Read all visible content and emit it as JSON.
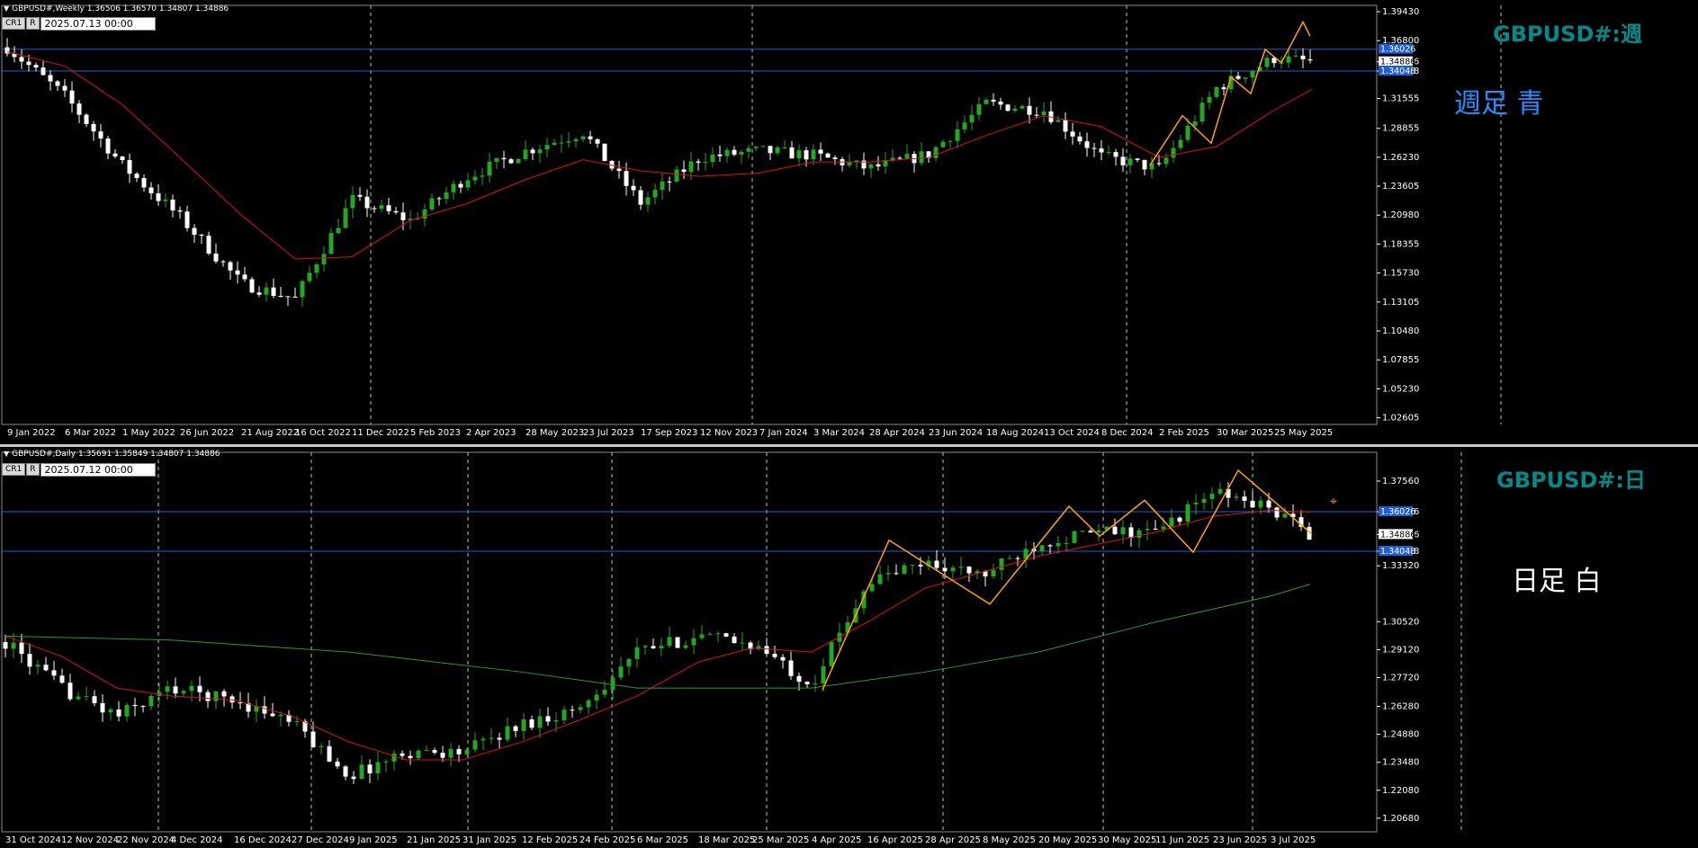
{
  "weekly": {
    "info": "GBPUSD#,Weekly  1.36506 1.36570 1.34807 1.34886",
    "buttons": [
      "CR1",
      "R"
    ],
    "datetime": "2025.07.13 00:00",
    "title": "GBPUSD#:週",
    "note": "週足  青",
    "price_ticks": [
      "1.39430",
      "1.36800",
      "1.34886",
      "1.34048",
      "1.31555",
      "1.28855",
      "1.26230",
      "1.23605",
      "1.20980",
      "1.18355",
      "1.15730",
      "1.13105",
      "1.10480",
      "1.07855",
      "1.05230",
      "1.02605"
    ],
    "hline_tags": [
      "1.36026",
      "1.34886",
      "1.34048"
    ],
    "date_labels": [
      "9 Jan 2022",
      "6 Mar 2022",
      "1 May 2022",
      "26 Jun 2022",
      "21 Aug 2022",
      "16 Oct 2022",
      "11 Dec 2022",
      "5 Feb 2023",
      "2 Apr 2023",
      "28 May 2023",
      "23 Jul 2023",
      "17 Sep 2023",
      "12 Nov 2023",
      "7 Jan 2024",
      "3 Mar 2024",
      "28 Apr 2024",
      "23 Jun 2024",
      "18 Aug 2024",
      "13 Oct 2024",
      "8 Dec 2024",
      "2 Feb 2025",
      "30 Mar 2025",
      "25 May 2025"
    ],
    "colors": {
      "bull": "#22a822",
      "bear": "#ffffff",
      "ma": "#e01010",
      "zigzag": "#ffa500",
      "hline": "#1e5fd8",
      "title": "#008b8b",
      "note": "#1e90ff"
    }
  },
  "daily": {
    "info": "GBPUSD#,Daily  1.35691 1.35849 1.34807 1.34886",
    "buttons": [
      "CR1",
      "R"
    ],
    "datetime": "2025.07.12 00:00",
    "title": "GBPUSD#:日",
    "note": "日足    白",
    "price_ticks": [
      "1.37560",
      "1.36026",
      "1.34886",
      "1.34048",
      "1.33320",
      "1.30520",
      "1.29120",
      "1.27720",
      "1.26280",
      "1.24880",
      "1.23480",
      "1.22080",
      "1.20680"
    ],
    "hline_tags": [
      "1.36026",
      "1.34886",
      "1.34048"
    ],
    "date_labels": [
      "31 Oct 2024",
      "12 Nov 2024",
      "22 Nov 2024",
      "4 Dec 2024",
      "16 Dec 2024",
      "27 Dec 2024",
      "9 Jan 2025",
      "21 Jan 2025",
      "31 Jan 2025",
      "12 Feb 2025",
      "24 Feb 2025",
      "6 Mar 2025",
      "18 Mar 2025",
      "25 Mar 2025",
      "4 Apr 2025",
      "16 Apr 2025",
      "28 Apr 2025",
      "8 May 2025",
      "20 May 2025",
      "30 May 2025",
      "11 Jun 2025",
      "23 Jun 2025",
      "3 Jul 2025"
    ],
    "colors": {
      "bull": "#22a822",
      "bear": "#ffffff",
      "ma_fast": "#e01010",
      "ma_slow": "#2a9a2a",
      "zigzag": "#ffa500",
      "hline": "#1e5fd8",
      "title": "#008b8b",
      "note": "#ffffff"
    }
  },
  "chart_data": [
    {
      "type": "candlestick",
      "title": "GBPUSD#:週",
      "timeframe": "Weekly",
      "ylim": [
        1.02,
        1.4
      ],
      "last_ohlc": {
        "open": 1.36506,
        "high": 1.3657,
        "low": 1.34807,
        "close": 1.34886
      },
      "horizontal_lines": [
        1.36026,
        1.34048
      ],
      "close_trace": [
        [
          "9 Jan 2022",
          1.362
        ],
        [
          "6 Mar 2022",
          1.318
        ],
        [
          "1 May 2022",
          1.255
        ],
        [
          "26 Jun 2022",
          1.208
        ],
        [
          "21 Aug 2022",
          1.148
        ],
        [
          "16 Oct 2022",
          1.134
        ],
        [
          "11 Dec 2022",
          1.224
        ],
        [
          "5 Feb 2023",
          1.205
        ],
        [
          "2 Apr 2023",
          1.244
        ],
        [
          "28 May 2023",
          1.268
        ],
        [
          "23 Jul 2023",
          1.285
        ],
        [
          "17 Sep 2023",
          1.221
        ],
        [
          "12 Nov 2023",
          1.262
        ],
        [
          "7 Jan 2024",
          1.268
        ],
        [
          "3 Mar 2024",
          1.264
        ],
        [
          "28 Apr 2024",
          1.252
        ],
        [
          "23 Jun 2024",
          1.265
        ],
        [
          "18 Aug 2024",
          1.311
        ],
        [
          "13 Oct 2024",
          1.305
        ],
        [
          "8 Dec 2024",
          1.263
        ],
        [
          "2 Feb 2025",
          1.252
        ],
        [
          "30 Mar 2025",
          1.325
        ],
        [
          "25 May 2025",
          1.352
        ],
        [
          "13 Jul 2025",
          1.349
        ]
      ],
      "ma_trace": [
        [
          "9 Jan 2022",
          1.358
        ],
        [
          "6 Mar 2022",
          1.345
        ],
        [
          "1 May 2022",
          1.31
        ],
        [
          "26 Jun 2022",
          1.262
        ],
        [
          "21 Aug 2022",
          1.21
        ],
        [
          "16 Oct 2022",
          1.17
        ],
        [
          "11 Dec 2022",
          1.172
        ],
        [
          "5 Feb 2023",
          1.205
        ],
        [
          "2 Apr 2023",
          1.22
        ],
        [
          "28 May 2023",
          1.242
        ],
        [
          "23 Jul 2023",
          1.26
        ],
        [
          "17 Sep 2023",
          1.25
        ],
        [
          "12 Nov 2023",
          1.245
        ],
        [
          "7 Jan 2024",
          1.248
        ],
        [
          "3 Mar 2024",
          1.258
        ],
        [
          "28 Apr 2024",
          1.258
        ],
        [
          "23 Jun 2024",
          1.262
        ],
        [
          "18 Aug 2024",
          1.282
        ],
        [
          "13 Oct 2024",
          1.3
        ],
        [
          "8 Dec 2024",
          1.29
        ],
        [
          "2 Feb 2025",
          1.262
        ],
        [
          "30 Mar 2025",
          1.272
        ],
        [
          "25 May 2025",
          1.305
        ],
        [
          "13 Jul 2025",
          1.324
        ]
      ]
    },
    {
      "type": "candlestick",
      "title": "GBPUSD#:日",
      "timeframe": "Daily",
      "ylim": [
        1.2,
        1.39
      ],
      "last_ohlc": {
        "open": 1.35691,
        "high": 1.35849,
        "low": 1.34807,
        "close": 1.34886
      },
      "horizontal_lines": [
        1.36026,
        1.34048
      ],
      "close_trace": [
        [
          "31 Oct 2024",
          1.295
        ],
        [
          "12 Nov 2024",
          1.272
        ],
        [
          "22 Nov 2024",
          1.258
        ],
        [
          "4 Dec 2024",
          1.272
        ],
        [
          "16 Dec 2024",
          1.266
        ],
        [
          "27 Dec 2024",
          1.255
        ],
        [
          "9 Jan 2025",
          1.228
        ],
        [
          "21 Jan 2025",
          1.24
        ],
        [
          "31 Jan 2025",
          1.24
        ],
        [
          "12 Feb 2025",
          1.254
        ],
        [
          "24 Feb 2025",
          1.262
        ],
        [
          "6 Mar 2025",
          1.29
        ],
        [
          "18 Mar 2025",
          1.298
        ],
        [
          "25 Mar 2025",
          1.294
        ],
        [
          "4 Apr 2025",
          1.274
        ],
        [
          "16 Apr 2025",
          1.325
        ],
        [
          "28 Apr 2025",
          1.335
        ],
        [
          "8 May 2025",
          1.328
        ],
        [
          "20 May 2025",
          1.345
        ],
        [
          "30 May 2025",
          1.35
        ],
        [
          "11 Jun 2025",
          1.35
        ],
        [
          "23 Jun 2025",
          1.37
        ],
        [
          "3 Jul 2025",
          1.362
        ],
        [
          "11 Jul 2025",
          1.349
        ]
      ],
      "ma_fast_trace": [
        [
          "31 Oct 2024",
          1.298
        ],
        [
          "12 Nov 2024",
          1.288
        ],
        [
          "22 Nov 2024",
          1.272
        ],
        [
          "4 Dec 2024",
          1.268
        ],
        [
          "16 Dec 2024",
          1.266
        ],
        [
          "27 Dec 2024",
          1.258
        ],
        [
          "9 Jan 2025",
          1.245
        ],
        [
          "21 Jan 2025",
          1.236
        ],
        [
          "31 Jan 2025",
          1.236
        ],
        [
          "12 Feb 2025",
          1.245
        ],
        [
          "24 Feb 2025",
          1.256
        ],
        [
          "6 Mar 2025",
          1.268
        ],
        [
          "18 Mar 2025",
          1.285
        ],
        [
          "25 Mar 2025",
          1.292
        ],
        [
          "4 Apr 2025",
          1.29
        ],
        [
          "16 Apr 2025",
          1.305
        ],
        [
          "28 Apr 2025",
          1.322
        ],
        [
          "8 May 2025",
          1.33
        ],
        [
          "20 May 2025",
          1.338
        ],
        [
          "30 May 2025",
          1.344
        ],
        [
          "11 Jun 2025",
          1.35
        ],
        [
          "23 Jun 2025",
          1.358
        ],
        [
          "3 Jul 2025",
          1.361
        ],
        [
          "11 Jul 2025",
          1.36
        ]
      ],
      "ma_slow_trace": [
        [
          "31 Oct 2024",
          1.298
        ],
        [
          "4 Dec 2024",
          1.296
        ],
        [
          "9 Jan 2025",
          1.29
        ],
        [
          "12 Feb 2025",
          1.28
        ],
        [
          "6 Mar 2025",
          1.272
        ],
        [
          "4 Apr 2025",
          1.272
        ],
        [
          "28 Apr 2025",
          1.28
        ],
        [
          "20 May 2025",
          1.29
        ],
        [
          "11 Jun 2025",
          1.305
        ],
        [
          "3 Jul 2025",
          1.318
        ],
        [
          "11 Jul 2025",
          1.324
        ]
      ]
    }
  ]
}
